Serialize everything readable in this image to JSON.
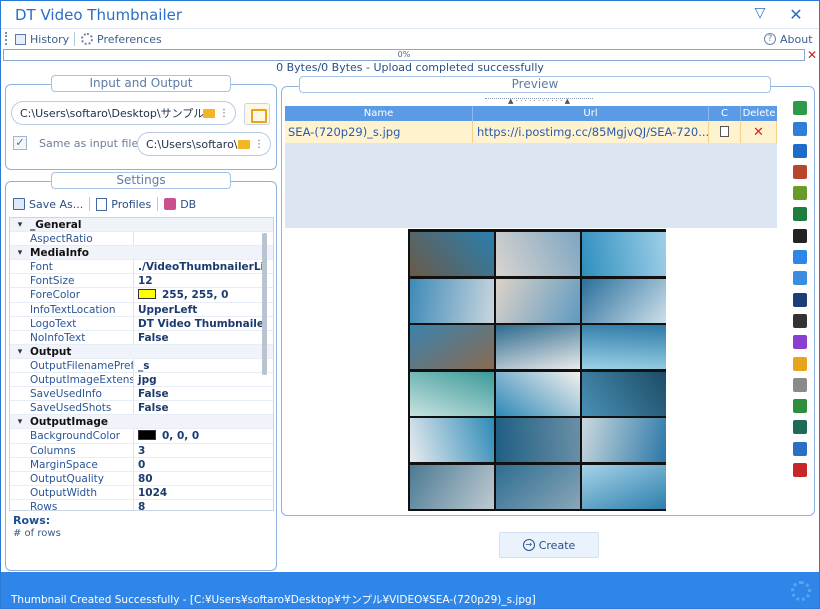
{
  "window": {
    "title": "DT Video Thumbnailer",
    "minimize_glyph": "▽",
    "close_glyph": "✕"
  },
  "menu": {
    "history": "History",
    "preferences": "Preferences",
    "about": "About"
  },
  "progress": {
    "percent_text": "0%",
    "percent": 0,
    "status": "0 Bytes/0 Bytes - Upload completed successfully"
  },
  "input_output": {
    "title": "Input and Output",
    "input_path": "C:\\Users\\softaro\\Desktop\\サンプル\\V",
    "same_as_input_label": "Same as input file",
    "same_as_input_checked": true,
    "output_path": "C:\\Users\\softaro\\D"
  },
  "settings": {
    "title": "Settings",
    "toolbar": {
      "save_as": "Save As...",
      "profiles": "Profiles",
      "db": "DB"
    },
    "rows": [
      {
        "type": "cat",
        "name": "_General"
      },
      {
        "type": "prop",
        "name": "AspectRatio",
        "value": ""
      },
      {
        "type": "cat",
        "name": "MediaInfo"
      },
      {
        "type": "prop",
        "name": "Font",
        "value": "./VideoThumbnailerLi"
      },
      {
        "type": "prop",
        "name": "FontSize",
        "value": "12"
      },
      {
        "type": "prop",
        "name": "ForeColor",
        "value": "255, 255, 0",
        "swatch": "#ffff00"
      },
      {
        "type": "prop",
        "name": "InfoTextLocation",
        "value": "UpperLeft"
      },
      {
        "type": "prop",
        "name": "LogoText",
        "value": "DT Video Thumbnaile"
      },
      {
        "type": "prop",
        "name": "NoInfoText",
        "value": "False"
      },
      {
        "type": "cat",
        "name": "Output"
      },
      {
        "type": "prop",
        "name": "OutputFilenamePrefix",
        "value": "_s"
      },
      {
        "type": "prop",
        "name": "OutputImageExtension",
        "value": "jpg"
      },
      {
        "type": "prop",
        "name": "SaveUsedInfo",
        "value": "False"
      },
      {
        "type": "prop",
        "name": "SaveUsedShots",
        "value": "False"
      },
      {
        "type": "cat",
        "name": "OutputImage"
      },
      {
        "type": "prop",
        "name": "BackgroundColor",
        "value": "0, 0, 0",
        "swatch": "#000000"
      },
      {
        "type": "prop",
        "name": "Columns",
        "value": "3"
      },
      {
        "type": "prop",
        "name": "MarginSpace",
        "value": "0"
      },
      {
        "type": "prop",
        "name": "OutputQuality",
        "value": "80"
      },
      {
        "type": "prop",
        "name": "OutputWidth",
        "value": "1024"
      },
      {
        "type": "prop",
        "name": "Rows",
        "value": "8"
      }
    ],
    "help_title": "Rows:",
    "help_desc": "# of rows"
  },
  "preview": {
    "title": "Preview",
    "headers": {
      "name": "Name",
      "url": "Url",
      "c": "C",
      "delete": "Delete"
    },
    "upload": {
      "name": "SEA-(720p29)_s.jpg",
      "url": "https://i.postimg.cc/85MgjvQJ/SEA-720..."
    },
    "side_icons": [
      {
        "name": "image-host-icon",
        "color": "#2e9a4a"
      },
      {
        "name": "upload-cloud-icon",
        "color": "#2f7fd8"
      },
      {
        "name": "postimage-icon",
        "color": "#1f6bc9"
      },
      {
        "name": "bird-icon",
        "color": "#b6462c"
      },
      {
        "name": "stack-icon",
        "color": "#6a9a2a"
      },
      {
        "name": "eye-icon",
        "color": "#1d7d3e"
      },
      {
        "name": "film-icon",
        "color": "#222222"
      },
      {
        "name": "imgbox-icon",
        "color": "#2f86e8"
      },
      {
        "name": "ibb-icon",
        "color": "#3a8de0"
      },
      {
        "name": "window-icon",
        "color": "#1c3f7a"
      },
      {
        "name": "monitor-icon",
        "color": "#333333"
      },
      {
        "name": "pen-icon",
        "color": "#8a3fd0"
      },
      {
        "name": "sparkle-icon",
        "color": "#e6a51c"
      },
      {
        "name": "disc-icon",
        "color": "#8a8a8a"
      },
      {
        "name": "photo-icon",
        "color": "#2d8f3e"
      },
      {
        "name": "landscape-icon",
        "color": "#1f6b5a"
      },
      {
        "name": "wave-icon",
        "color": "#2a6fc4"
      },
      {
        "name": "acrobat-icon",
        "color": "#c62828"
      }
    ]
  },
  "create_button": "Create",
  "status": "Thumbnail Created Successfully - [C:¥Users¥softaro¥Desktop¥サンプル¥VIDEO¥SEA-(720p29)_s.jpg]"
}
